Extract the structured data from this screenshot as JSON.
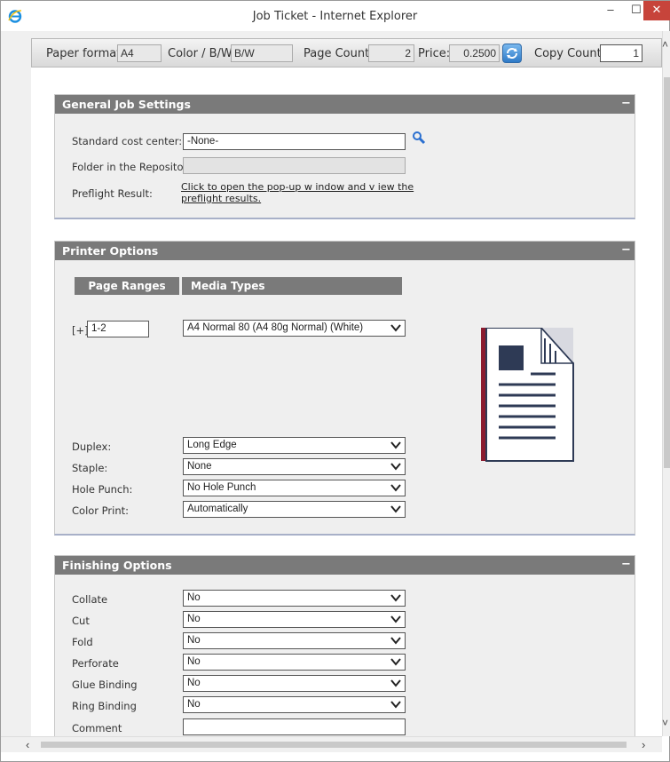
{
  "window": {
    "title": "Job Ticket - Internet Explorer"
  },
  "topbar": {
    "paper_format_label": "Paper format:",
    "paper_format_value": "A4",
    "color_label": "Color / B/W:",
    "color_value": "B/W",
    "page_count_label": "Page Count:",
    "page_count_value": "2",
    "price_label": "Price:",
    "price_value": "0.2500",
    "copy_count_label": "Copy Count:",
    "copy_count_value": "1"
  },
  "general": {
    "title": "General Job Settings",
    "cost_center_label": "Standard cost center:",
    "cost_center_value": "-None-",
    "folder_label": "Folder in the Repository:",
    "folder_value": "",
    "preflight_label": "Preflight Result:",
    "preflight_link": "Click to open the pop-up w indow and v iew the preflight results."
  },
  "printer": {
    "title": "Printer Options",
    "col_page_ranges": "Page Ranges",
    "col_media_types": "Media Types",
    "range_expand": "[+]",
    "range_value": "1-2",
    "media_value": "A4 Normal 80 (A4 80g Normal) (White)",
    "duplex_label": "Duplex:",
    "duplex_value": "Long Edge",
    "staple_label": "Staple:",
    "staple_value": "None",
    "hole_label": "Hole Punch:",
    "hole_value": "No Hole Punch",
    "color_label": "Color Print:",
    "color_value": "Automatically"
  },
  "finishing": {
    "title": "Finishing Options",
    "rows": [
      {
        "label": "Collate",
        "value": "No"
      },
      {
        "label": "Cut",
        "value": "No"
      },
      {
        "label": "Fold",
        "value": "No"
      },
      {
        "label": "Perforate",
        "value": "No"
      },
      {
        "label": "Glue Binding",
        "value": "No"
      },
      {
        "label": "Ring Binding",
        "value": "No"
      }
    ],
    "comment_label": "Comment",
    "comment_value": ""
  },
  "icons": {
    "app": "internet-explorer-icon",
    "refresh": "refresh-icon",
    "search": "magnifier-icon",
    "document": "document-preview-icon",
    "dropdown": "chevron-down-icon"
  },
  "colors": {
    "panel_header": "#7a7a7a",
    "doc_accent": "#8b1c2f",
    "doc_ink": "#2e3a55"
  }
}
